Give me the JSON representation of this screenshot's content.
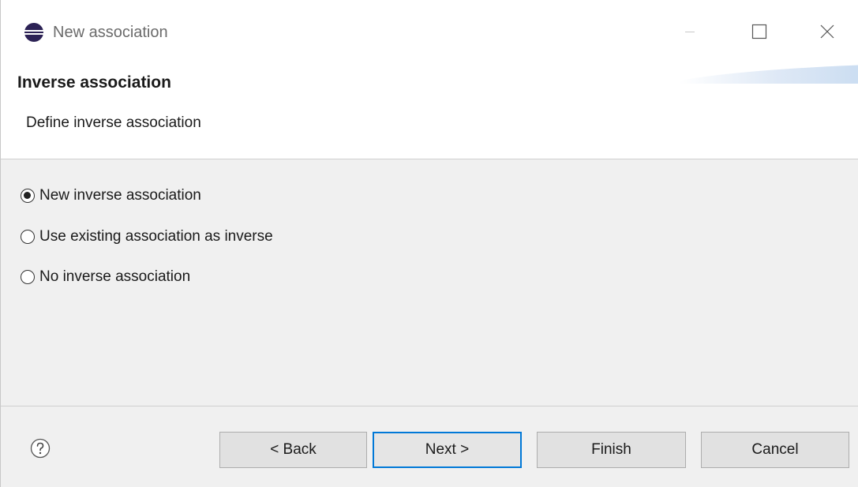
{
  "window": {
    "title": "New association",
    "icon": "eclipse-logo-icon",
    "controls": {
      "minimize": "minimize-icon",
      "maximize": "maximize-icon",
      "close": "close-icon"
    }
  },
  "header": {
    "title": "Inverse association",
    "subtitle": "Define inverse association"
  },
  "options": [
    {
      "label": "New inverse association",
      "checked": true
    },
    {
      "label": "Use existing association as inverse",
      "checked": false
    },
    {
      "label": "No inverse association",
      "checked": false
    }
  ],
  "footer": {
    "help_icon": "help-icon",
    "back_label": "< Back",
    "next_label": "Next >",
    "finish_label": "Finish",
    "cancel_label": "Cancel"
  },
  "colors": {
    "accent": "#0078d7",
    "body_background": "#f0f0f0",
    "button_background": "#e1e1e1"
  }
}
